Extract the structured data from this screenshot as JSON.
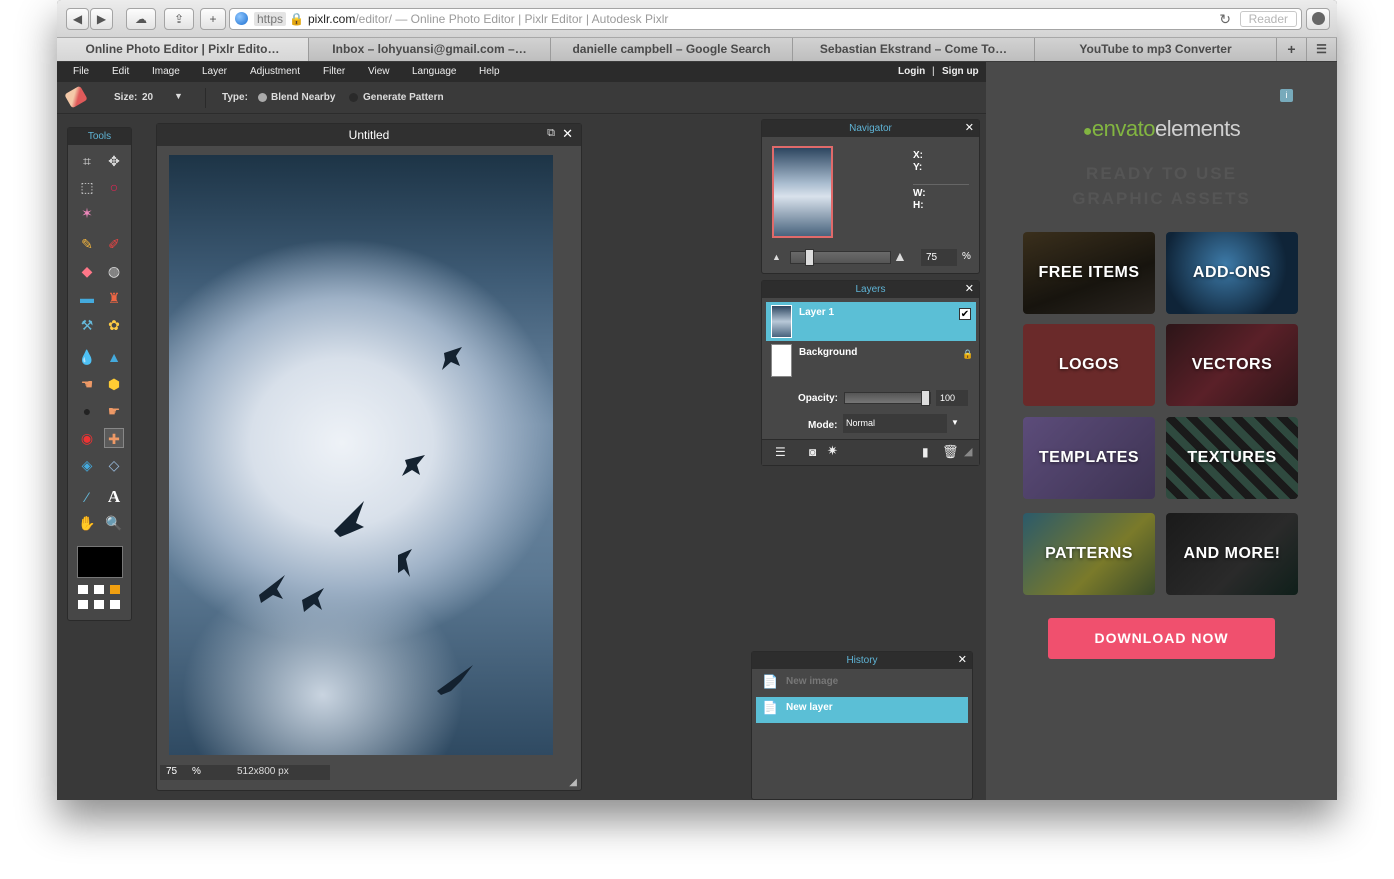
{
  "browser": {
    "address_https": "https",
    "address_domain": "pixlr.com",
    "address_rest": "/editor/ — Online Photo Editor | Pixlr Editor | Autodesk Pixlr",
    "reader_label": "Reader",
    "tabs": [
      {
        "label": "Online Photo Editor | Pixlr Edito…"
      },
      {
        "label": "Inbox – lohyuansi@gmail.com –…"
      },
      {
        "label": "danielle campbell – Google Search"
      },
      {
        "label": "Sebastian Ekstrand – Come To…"
      },
      {
        "label": "YouTube to mp3 Converter"
      }
    ]
  },
  "menu": {
    "file": "File",
    "edit": "Edit",
    "image": "Image",
    "layer": "Layer",
    "adjustment": "Adjustment",
    "filter": "Filter",
    "view": "View",
    "language": "Language",
    "help": "Help",
    "login": "Login",
    "separator": "|",
    "signup": "Sign up"
  },
  "options": {
    "size_label": "Size:",
    "size_value": "20",
    "type_label": "Type:",
    "blend_nearby": "Blend Nearby",
    "generate_pattern": "Generate Pattern"
  },
  "tools_panel": {
    "title": "Tools"
  },
  "document": {
    "title": "Untitled",
    "zoom": "75",
    "zoom_unit": "%",
    "dimensions": "512x800 px"
  },
  "navigator": {
    "title": "Navigator",
    "x_label": "X:",
    "y_label": "Y:",
    "w_label": "W:",
    "h_label": "H:",
    "zoom_value": "75",
    "zoom_unit": "%"
  },
  "layers": {
    "title": "Layers",
    "items": [
      {
        "name": "Layer 1",
        "selected": true
      },
      {
        "name": "Background",
        "selected": false
      }
    ],
    "opacity_label": "Opacity:",
    "opacity_value": "100",
    "mode_label": "Mode:",
    "mode_value": "Normal"
  },
  "history": {
    "title": "History",
    "items": [
      {
        "label": "New image",
        "active": false
      },
      {
        "label": "New layer",
        "active": true
      }
    ]
  },
  "ad": {
    "brand": "envato",
    "brand_suffix": "elements",
    "tagline_1": "READY TO USE",
    "tagline_2": "GRAPHIC ASSETS",
    "tiles": [
      {
        "label": "FREE ITEMS"
      },
      {
        "label": "ADD-ONS"
      },
      {
        "label": "LOGOS"
      },
      {
        "label": "VECTORS"
      },
      {
        "label": "TEMPLATES"
      },
      {
        "label": "TEXTURES"
      },
      {
        "label": "PATTERNS"
      },
      {
        "label": "AND MORE!"
      }
    ],
    "cta": "DOWNLOAD NOW",
    "cta_color": "#f0506e",
    "accent_green": "#82b541"
  },
  "colors": {
    "panel_title": "#5fb4d6",
    "selection": "#5bbfd6"
  }
}
